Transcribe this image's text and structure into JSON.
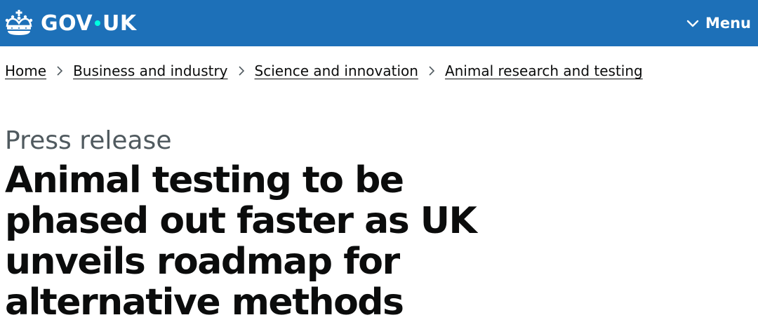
{
  "header": {
    "logo_left": "GOV",
    "logo_right": "UK",
    "logo_icon": "crown-icon",
    "menu_label": "Menu",
    "menu_icon": "chevron-down-icon",
    "background_color": "#1d70b8",
    "dot_color": "#00ffe0"
  },
  "breadcrumb": {
    "items": [
      {
        "label": "Home"
      },
      {
        "label": "Business and industry"
      },
      {
        "label": "Science and innovation"
      },
      {
        "label": "Animal research and testing"
      }
    ],
    "separator_icon": "chevron-right-icon"
  },
  "main": {
    "caption": "Press release",
    "title": "Animal testing to be phased out faster as UK unveils roadmap for alternative methods"
  }
}
